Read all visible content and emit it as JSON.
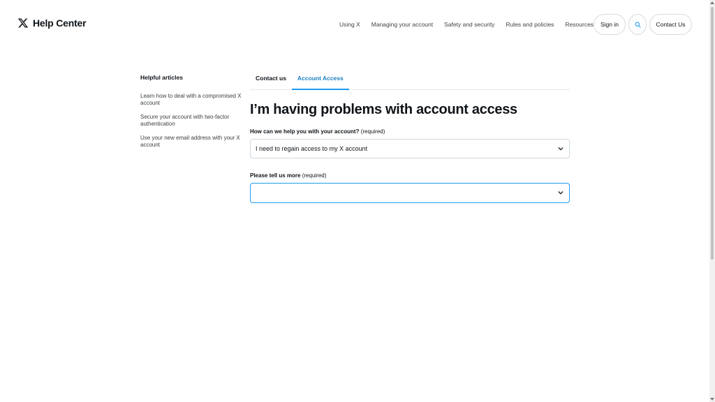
{
  "header": {
    "logo_text": "Help Center",
    "nav": [
      "Using X",
      "Managing your account",
      "Safety and security",
      "Rules and policies",
      "Resources"
    ],
    "signin_label": "Sign in",
    "contact_label": "Contact Us"
  },
  "sidebar": {
    "title": "Helpful articles",
    "links": [
      "Learn how to deal with a compromised X account",
      "Secure your account with two-factor authentication",
      "Use your new email address with your X account"
    ]
  },
  "main": {
    "tabs": [
      {
        "label": "Contact us",
        "active": false
      },
      {
        "label": "Account Access",
        "active": true
      }
    ],
    "title": "I’m having problems with account access",
    "field1": {
      "label": "How can we help you with your account?",
      "required": "(required)",
      "value": "I need to regain access to my X account"
    },
    "field2": {
      "label": "Please tell us more",
      "required": "(required)",
      "value": ""
    }
  },
  "colors": {
    "accent": "#1d9bf0",
    "active_tab_text": "#1d80c3",
    "text": "#0f1419",
    "border": "#cfd9de"
  }
}
